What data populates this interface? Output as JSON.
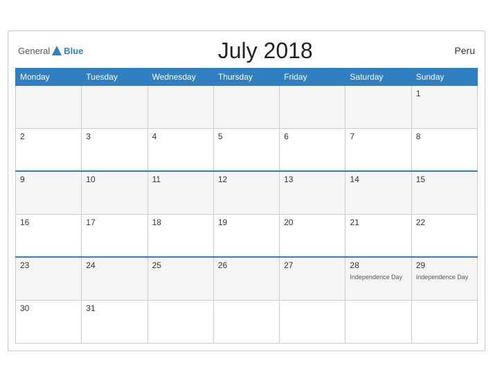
{
  "header": {
    "title": "July 2018",
    "country": "Peru",
    "logo_general": "General",
    "logo_blue": "Blue"
  },
  "columns": [
    "Monday",
    "Tuesday",
    "Wednesday",
    "Thursday",
    "Friday",
    "Saturday",
    "Sunday"
  ],
  "weeks": [
    [
      {
        "day": "",
        "event": ""
      },
      {
        "day": "",
        "event": ""
      },
      {
        "day": "",
        "event": ""
      },
      {
        "day": "",
        "event": ""
      },
      {
        "day": "",
        "event": ""
      },
      {
        "day": "",
        "event": ""
      },
      {
        "day": "1",
        "event": ""
      }
    ],
    [
      {
        "day": "2",
        "event": ""
      },
      {
        "day": "3",
        "event": ""
      },
      {
        "day": "4",
        "event": ""
      },
      {
        "day": "5",
        "event": ""
      },
      {
        "day": "6",
        "event": ""
      },
      {
        "day": "7",
        "event": ""
      },
      {
        "day": "8",
        "event": ""
      }
    ],
    [
      {
        "day": "9",
        "event": ""
      },
      {
        "day": "10",
        "event": ""
      },
      {
        "day": "11",
        "event": ""
      },
      {
        "day": "12",
        "event": ""
      },
      {
        "day": "13",
        "event": ""
      },
      {
        "day": "14",
        "event": ""
      },
      {
        "day": "15",
        "event": ""
      }
    ],
    [
      {
        "day": "16",
        "event": ""
      },
      {
        "day": "17",
        "event": ""
      },
      {
        "day": "18",
        "event": ""
      },
      {
        "day": "19",
        "event": ""
      },
      {
        "day": "20",
        "event": ""
      },
      {
        "day": "21",
        "event": ""
      },
      {
        "day": "22",
        "event": ""
      }
    ],
    [
      {
        "day": "23",
        "event": ""
      },
      {
        "day": "24",
        "event": ""
      },
      {
        "day": "25",
        "event": ""
      },
      {
        "day": "26",
        "event": ""
      },
      {
        "day": "27",
        "event": ""
      },
      {
        "day": "28",
        "event": "Independence Day"
      },
      {
        "day": "29",
        "event": "Independence Day"
      }
    ],
    [
      {
        "day": "30",
        "event": ""
      },
      {
        "day": "31",
        "event": ""
      },
      {
        "day": "",
        "event": ""
      },
      {
        "day": "",
        "event": ""
      },
      {
        "day": "",
        "event": ""
      },
      {
        "day": "",
        "event": ""
      },
      {
        "day": "",
        "event": ""
      }
    ]
  ],
  "blue_rows": [
    2,
    4
  ]
}
